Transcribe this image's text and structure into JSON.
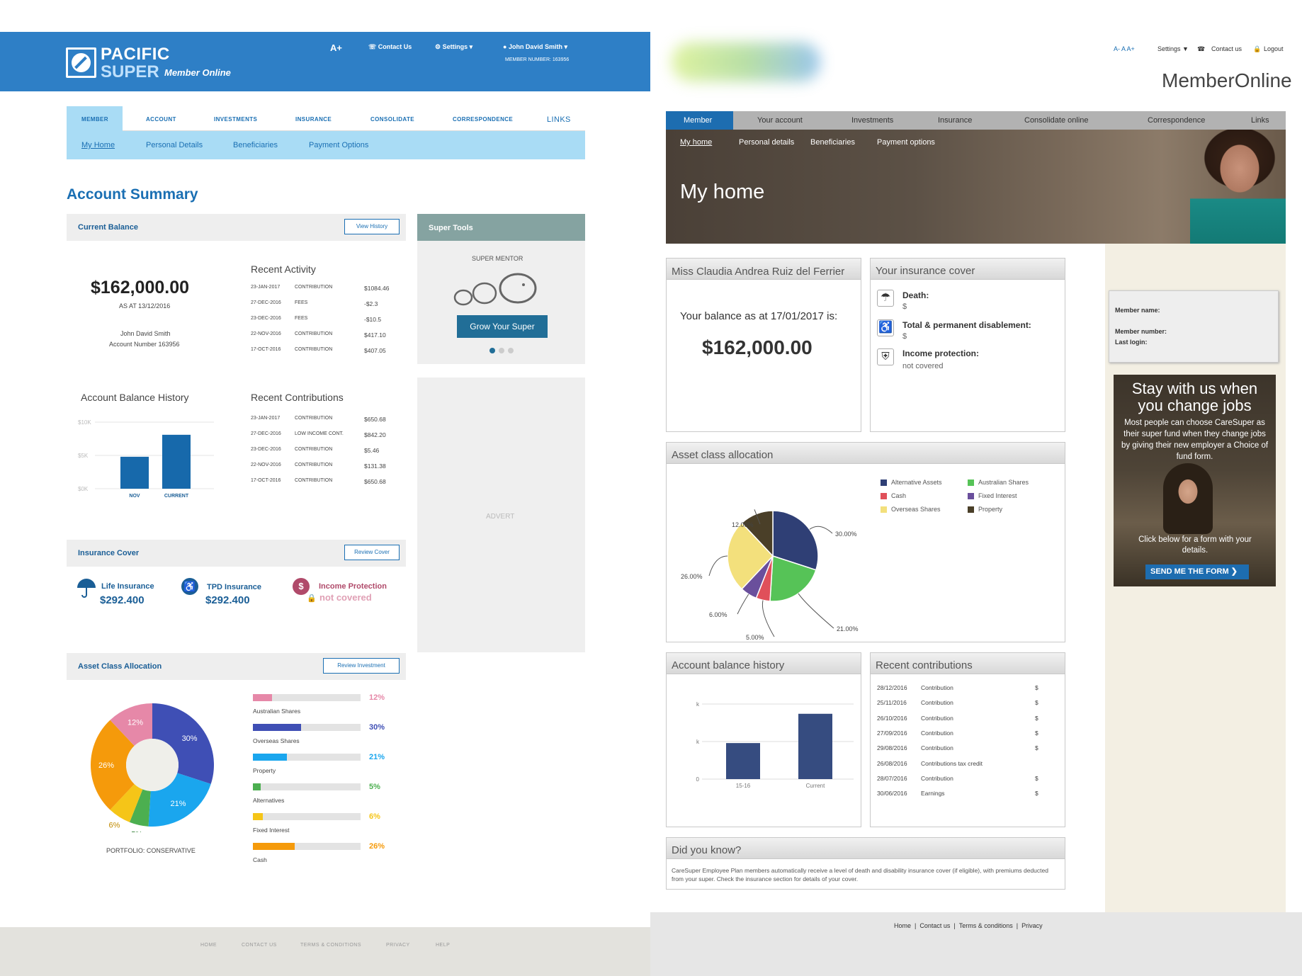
{
  "left": {
    "brand": {
      "line1": "PACIFIC",
      "line2": "SUPER",
      "tagline": "Member Online"
    },
    "header": {
      "font_size": "A+",
      "contact": "Contact Us",
      "settings": "Settings",
      "user": "John David Smith",
      "member_number": "MEMBER NUMBER: 163956"
    },
    "nav": [
      "MEMBER",
      "ACCOUNT",
      "INVESTMENTS",
      "INSURANCE",
      "CONSOLIDATE",
      "CORRESPONDENCE",
      "LINKS"
    ],
    "subnav": [
      "My Home",
      "Personal Details",
      "Beneficiaries",
      "Payment Options"
    ],
    "title": "Account Summary",
    "current_balance": {
      "heading": "Current Balance",
      "button": "View History",
      "amount": "$162,000.00",
      "as_at": "AS AT 13/12/2016",
      "name": "John David Smith",
      "account": "Account Number 163956"
    },
    "recent_activity": {
      "heading": "Recent Activity",
      "rows": [
        {
          "date": "23-JAN-2017",
          "type": "CONTRIBUTION",
          "amount": "$1084.46"
        },
        {
          "date": "27-DEC-2016",
          "type": "FEES",
          "amount": "-$2.3"
        },
        {
          "date": "23-DEC-2016",
          "type": "FEES",
          "amount": "-$10.5"
        },
        {
          "date": "22-NOV-2016",
          "type": "CONTRIBUTION",
          "amount": "$417.10"
        },
        {
          "date": "17-OCT-2016",
          "type": "CONTRIBUTION",
          "amount": "$407.05"
        }
      ]
    },
    "balance_history": {
      "heading": "Account Balance History",
      "ticks": [
        "$10K",
        "$5K",
        "$0K"
      ],
      "chart_data": {
        "type": "bar",
        "categories": [
          "NOV",
          "CURRENT"
        ],
        "values": [
          4800,
          8100
        ],
        "ylim": [
          0,
          10000
        ]
      }
    },
    "recent_contributions": {
      "heading": "Recent Contributions",
      "rows": [
        {
          "date": "23-JAN-2017",
          "type": "CONTRIBUTION",
          "amount": "$650.68"
        },
        {
          "date": "27-DEC-2016",
          "type": "LOW INCOME CONT.",
          "amount": "$842.20"
        },
        {
          "date": "23-DEC-2016",
          "type": "CONTRIBUTION",
          "amount": "$5.46"
        },
        {
          "date": "22-NOV-2016",
          "type": "CONTRIBUTION",
          "amount": "$131.38"
        },
        {
          "date": "17-OCT-2016",
          "type": "CONTRIBUTION",
          "amount": "$650.68"
        }
      ]
    },
    "super_tools": {
      "heading": "Super Tools",
      "mentor": "SUPER MENTOR",
      "button": "Grow Your Super"
    },
    "advert": "ADVERT",
    "insurance": {
      "heading": "Insurance Cover",
      "button": "Review Cover",
      "items": [
        {
          "label": "Life Insurance",
          "value": "$292.400",
          "icon": "umbrella-icon"
        },
        {
          "label": "TPD Insurance",
          "value": "$292.400",
          "icon": "wheelchair-icon"
        },
        {
          "label": "Income Protection",
          "value": "not covered",
          "icon": "dollar-icon"
        }
      ]
    },
    "allocation": {
      "heading": "Asset Class Allocation",
      "button": "Review Investment",
      "portfolio": "PORTFOLIO: CONSERVATIVE",
      "donut_labels": [
        "30%",
        "21%",
        "5%",
        "6%",
        "26%",
        "12%"
      ],
      "chart_data": {
        "type": "pie",
        "categories": [
          "Overseas Shares",
          "Property",
          "Alternatives",
          "Fixed Interest",
          "Cash",
          "Australian Shares"
        ],
        "values": [
          30,
          21,
          5,
          6,
          26,
          12
        ],
        "colors": [
          "#3f4fb5",
          "#1aa6ee",
          "#4caf50",
          "#f5c518",
          "#f59a0b",
          "#e688a8"
        ]
      },
      "bars": [
        {
          "label": "Australian Shares",
          "pct": "12%",
          "value": 12,
          "color": "#e688a8"
        },
        {
          "label": "Overseas Shares",
          "pct": "30%",
          "value": 30,
          "color": "#3f4fb5"
        },
        {
          "label": "Property",
          "pct": "21%",
          "value": 21,
          "color": "#1aa6ee"
        },
        {
          "label": "Alternatives",
          "pct": "5%",
          "value": 5,
          "color": "#4caf50"
        },
        {
          "label": "Fixed Interest",
          "pct": "6%",
          "value": 6,
          "color": "#f5c518"
        },
        {
          "label": "Cash",
          "pct": "26%",
          "value": 26,
          "color": "#f59a0b"
        }
      ]
    },
    "footer": [
      "HOME",
      "CONTACT US",
      "TERMS & CONDITIONS",
      "PRIVACY",
      "HELP"
    ]
  },
  "right": {
    "top_links": {
      "font": "A-  A  A+",
      "settings": "Settings ▼",
      "contact": "Contact us",
      "logout": "Logout"
    },
    "app_title": "MemberOnline",
    "nav": [
      "Member",
      "Your account",
      "Investments",
      "Insurance",
      "Consolidate online",
      "Correspondence",
      "Links"
    ],
    "subnav": [
      "My home",
      "Personal details",
      "Beneficiaries",
      "Payment options"
    ],
    "hero_title": "My home",
    "member_box": {
      "name": "Miss Claudia Andrea Ruiz del Ferrier",
      "balance_label": "Your balance as at 17/01/2017 is:",
      "balance": "$162,000.00"
    },
    "insurance": {
      "heading": "Your insurance cover",
      "items": [
        {
          "label": "Death:",
          "value": "$"
        },
        {
          "label": "Total & permanent disablement:",
          "value": "$"
        },
        {
          "label": "Income protection:",
          "value": "not covered"
        }
      ]
    },
    "allocation": {
      "heading": "Asset class allocation",
      "legend": [
        {
          "label": "Alternative Assets",
          "color": "#2f3f75"
        },
        {
          "label": "Australian Shares",
          "color": "#56c357"
        },
        {
          "label": "Cash",
          "color": "#e0505a"
        },
        {
          "label": "Fixed Interest",
          "color": "#6a4f9c"
        },
        {
          "label": "Overseas Shares",
          "color": "#f3e07c"
        },
        {
          "label": "Property",
          "color": "#4a3f28"
        }
      ],
      "pie_labels": [
        "30.00%",
        "21.00%",
        "5.00%",
        "6.00%",
        "26.00%",
        "12.00%"
      ],
      "chart_data": {
        "type": "pie",
        "categories": [
          "Alternative Assets",
          "Australian Shares",
          "Cash",
          "Fixed Interest",
          "Overseas Shares",
          "Property"
        ],
        "values": [
          30,
          21,
          5,
          6,
          26,
          12
        ],
        "colors": [
          "#2f3f75",
          "#56c357",
          "#e0505a",
          "#6a4f9c",
          "#f3e07c",
          "#4a3f28"
        ]
      }
    },
    "balance_history": {
      "heading": "Account balance history",
      "ticks": [
        "k",
        "k",
        "0"
      ],
      "chart_data": {
        "type": "bar",
        "categories": [
          "15-16",
          "Current"
        ],
        "values": [
          48,
          87
        ],
        "ylim": [
          0,
          100
        ]
      }
    },
    "contributions": {
      "heading": "Recent contributions",
      "rows": [
        {
          "date": "28/12/2016",
          "type": "Contribution",
          "amount": "$"
        },
        {
          "date": "25/11/2016",
          "type": "Contribution",
          "amount": "$"
        },
        {
          "date": "26/10/2016",
          "type": "Contribution",
          "amount": "$"
        },
        {
          "date": "27/09/2016",
          "type": "Contribution",
          "amount": "$"
        },
        {
          "date": "29/08/2016",
          "type": "Contribution",
          "amount": "$"
        },
        {
          "date": "26/08/2016",
          "type": "Contributions tax credit",
          "amount": ""
        },
        {
          "date": "28/07/2016",
          "type": "Contribution",
          "amount": "$"
        },
        {
          "date": "30/06/2016",
          "type": "Earnings",
          "amount": "$"
        }
      ]
    },
    "did_you_know": {
      "heading": "Did you know?",
      "text": "CareSuper Employee Plan members automatically receive a level of death and disability insurance cover (if eligible), with premiums deducted from your super. Check the insurance section for details of your cover."
    },
    "member_info": {
      "name_label": "Member name:",
      "number_label": "Member number:",
      "login_label": "Last login:"
    },
    "promo": {
      "title": "Stay with us when you change jobs",
      "body": "Most people can choose CareSuper as their super fund when they change jobs by giving their new employer a Choice of fund form.",
      "cta_text": "Click below for a form with your details.",
      "button": "SEND ME THE FORM"
    },
    "footer": [
      "Home",
      "Contact us",
      "Terms & conditions",
      "Privacy"
    ]
  }
}
